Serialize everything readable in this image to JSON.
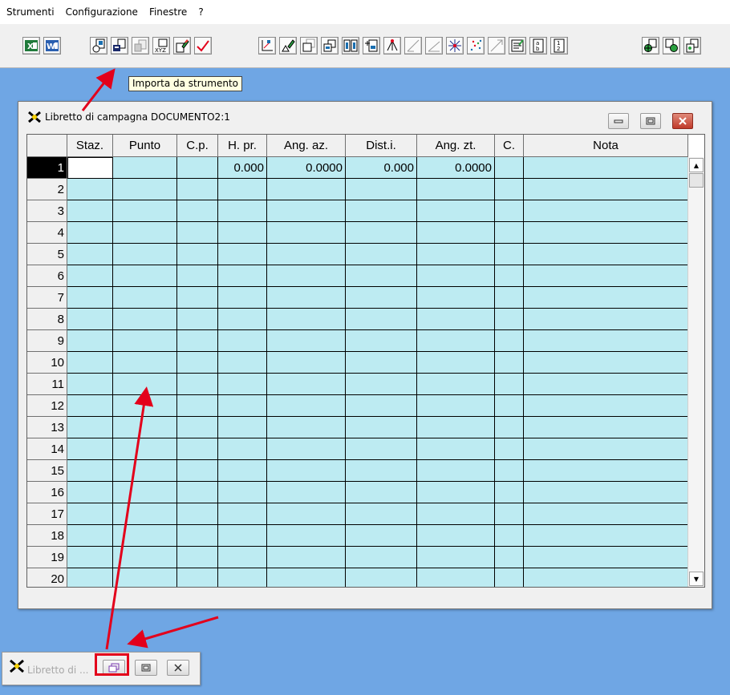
{
  "menu": {
    "items": [
      "Strumenti",
      "Configurazione",
      "Finestre",
      "?"
    ]
  },
  "toolbar": {
    "tooltip": "Importa da strumento",
    "icons": [
      "excel-icon",
      "word-icon",
      "instrument-download-icon",
      "import-instrument-icon",
      "import-generic-icon",
      "import-xyz-icon",
      "eraser-icon",
      "check-icon",
      "axes-icon",
      "pen-triangle-icon",
      "doc-copy-icon",
      "doc-split-icon",
      "doc-grid-icon",
      "doc-add-icon",
      "network-icon",
      "slope-line-icon",
      "angle-icon",
      "star-icon",
      "scatter-icon",
      "hexagon-icon",
      "notes-icon",
      "a-b-icon",
      "one-two-icon",
      "globe-doc-icon",
      "doc-globe-icon",
      "doc-export-icon"
    ],
    "accent": "#1a6fb0"
  },
  "window": {
    "title": "Libretto di campagna DOCUMENTO2:1",
    "columns": [
      "Staz.",
      "Punto",
      "C.p.",
      "H. pr.",
      "Ang. az.",
      "Dist.i.",
      "Ang. zt.",
      "C.",
      "Nota"
    ],
    "rows": [
      {
        "num": "1",
        "cells": [
          "",
          "",
          "",
          "0.000",
          "0.0000",
          "0.000",
          "0.0000",
          "",
          ""
        ]
      },
      {
        "num": "2",
        "cells": [
          "",
          "",
          "",
          "",
          "",
          "",
          "",
          "",
          ""
        ]
      },
      {
        "num": "3",
        "cells": [
          "",
          "",
          "",
          "",
          "",
          "",
          "",
          "",
          ""
        ]
      },
      {
        "num": "4",
        "cells": [
          "",
          "",
          "",
          "",
          "",
          "",
          "",
          "",
          ""
        ]
      },
      {
        "num": "5",
        "cells": [
          "",
          "",
          "",
          "",
          "",
          "",
          "",
          "",
          ""
        ]
      },
      {
        "num": "6",
        "cells": [
          "",
          "",
          "",
          "",
          "",
          "",
          "",
          "",
          ""
        ]
      },
      {
        "num": "7",
        "cells": [
          "",
          "",
          "",
          "",
          "",
          "",
          "",
          "",
          ""
        ]
      },
      {
        "num": "8",
        "cells": [
          "",
          "",
          "",
          "",
          "",
          "",
          "",
          "",
          ""
        ]
      },
      {
        "num": "9",
        "cells": [
          "",
          "",
          "",
          "",
          "",
          "",
          "",
          "",
          ""
        ]
      },
      {
        "num": "10",
        "cells": [
          "",
          "",
          "",
          "",
          "",
          "",
          "",
          "",
          ""
        ]
      },
      {
        "num": "11",
        "cells": [
          "",
          "",
          "",
          "",
          "",
          "",
          "",
          "",
          ""
        ]
      },
      {
        "num": "12",
        "cells": [
          "",
          "",
          "",
          "",
          "",
          "",
          "",
          "",
          ""
        ]
      },
      {
        "num": "13",
        "cells": [
          "",
          "",
          "",
          "",
          "",
          "",
          "",
          "",
          ""
        ]
      },
      {
        "num": "14",
        "cells": [
          "",
          "",
          "",
          "",
          "",
          "",
          "",
          "",
          ""
        ]
      },
      {
        "num": "15",
        "cells": [
          "",
          "",
          "",
          "",
          "",
          "",
          "",
          "",
          ""
        ]
      },
      {
        "num": "16",
        "cells": [
          "",
          "",
          "",
          "",
          "",
          "",
          "",
          "",
          ""
        ]
      },
      {
        "num": "17",
        "cells": [
          "",
          "",
          "",
          "",
          "",
          "",
          "",
          "",
          ""
        ]
      },
      {
        "num": "18",
        "cells": [
          "",
          "",
          "",
          "",
          "",
          "",
          "",
          "",
          ""
        ]
      },
      {
        "num": "19",
        "cells": [
          "",
          "",
          "",
          "",
          "",
          "",
          "",
          "",
          ""
        ]
      },
      {
        "num": "20",
        "cells": [
          "",
          "",
          "",
          "",
          "",
          "",
          "",
          "",
          ""
        ]
      }
    ],
    "active_row": 1,
    "cell_color": "#bdebf2"
  },
  "minimized": {
    "title": "Libretto di ..."
  },
  "colors": {
    "desktop": "#6fa6e4",
    "annotation": "#e3001b"
  }
}
